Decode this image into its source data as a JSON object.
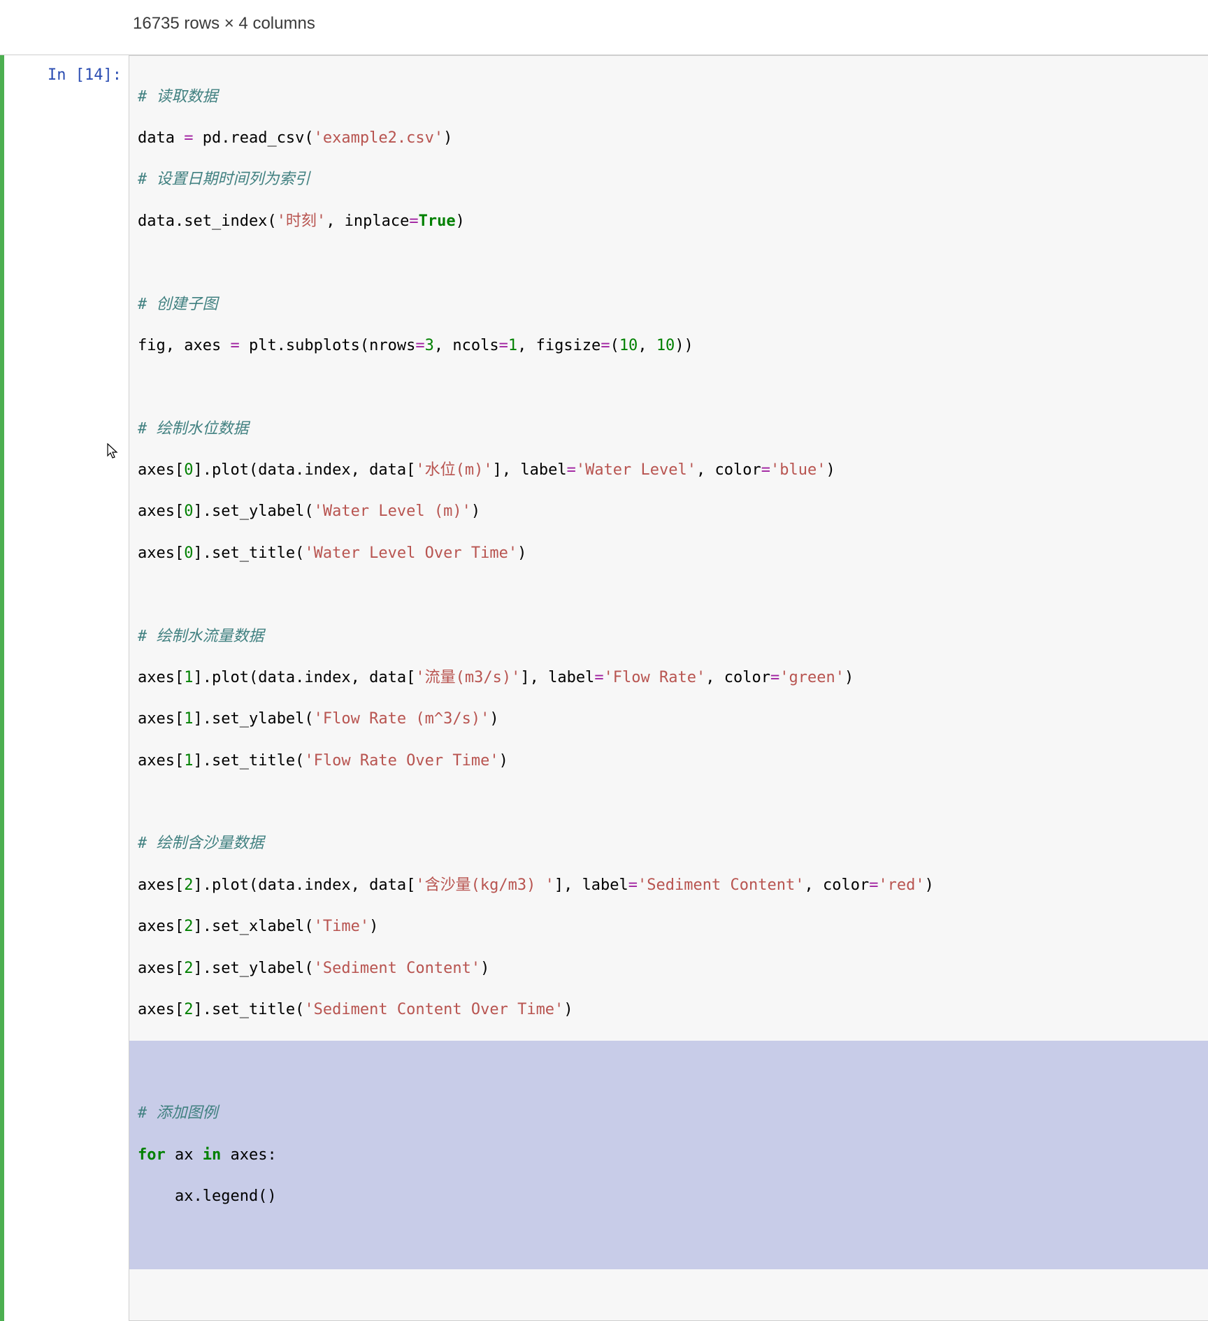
{
  "output": {
    "summary": "16735 rows × 4 columns"
  },
  "cell": {
    "prompt_label": "In",
    "prompt_number": "[14]:",
    "code": {
      "l01_comment": "# 读取数据",
      "l02_a": "data ",
      "l02_op": "=",
      "l02_b": " pd.read_csv(",
      "l02_str": "'example2.csv'",
      "l02_c": ")",
      "l03_comment": "# 设置日期时间列为索引",
      "l04_a": "data.set_index(",
      "l04_str": "'时刻'",
      "l04_b": ", inplace",
      "l04_op": "=",
      "l04_kw": "True",
      "l04_c": ")",
      "l05_blank": "",
      "l06_comment": "# 创建子图",
      "l07_a": "fig, axes ",
      "l07_op1": "=",
      "l07_b": " plt.subplots(nrows",
      "l07_op2": "=",
      "l07_n1": "3",
      "l07_c": ", ncols",
      "l07_op3": "=",
      "l07_n2": "1",
      "l07_d": ", figsize",
      "l07_op4": "=",
      "l07_e": "(",
      "l07_n3": "10",
      "l07_f": ", ",
      "l07_n4": "10",
      "l07_g": "))",
      "l08_blank": "",
      "l09_comment": "# 绘制水位数据",
      "l10_a": "axes[",
      "l10_n": "0",
      "l10_b": "].plot(data.index, data[",
      "l10_str1": "'水位(m)'",
      "l10_c": "], label",
      "l10_op1": "=",
      "l10_str2": "'Water Level'",
      "l10_d": ", color",
      "l10_op2": "=",
      "l10_str3": "'blue'",
      "l10_e": ")",
      "l11_a": "axes[",
      "l11_n": "0",
      "l11_b": "].set_ylabel(",
      "l11_str": "'Water Level (m)'",
      "l11_c": ")",
      "l12_a": "axes[",
      "l12_n": "0",
      "l12_b": "].set_title(",
      "l12_str": "'Water Level Over Time'",
      "l12_c": ")",
      "l13_blank": "",
      "l14_comment": "# 绘制水流量数据",
      "l15_a": "axes[",
      "l15_n": "1",
      "l15_b": "].plot(data.index, data[",
      "l15_str1": "'流量(m3/s)'",
      "l15_c": "], label",
      "l15_op1": "=",
      "l15_str2": "'Flow Rate'",
      "l15_d": ", color",
      "l15_op2": "=",
      "l15_str3": "'green'",
      "l15_e": ")",
      "l16_a": "axes[",
      "l16_n": "1",
      "l16_b": "].set_ylabel(",
      "l16_str": "'Flow Rate (m^3/s)'",
      "l16_c": ")",
      "l17_a": "axes[",
      "l17_n": "1",
      "l17_b": "].set_title(",
      "l17_str": "'Flow Rate Over Time'",
      "l17_c": ")",
      "l18_blank": "",
      "l19_comment": "# 绘制含沙量数据",
      "l20_a": "axes[",
      "l20_n": "2",
      "l20_b": "].plot(data.index, data[",
      "l20_str1": "'含沙量(kg/m3) '",
      "l20_c": "], label",
      "l20_op1": "=",
      "l20_str2": "'Sediment Content'",
      "l20_d": ", color",
      "l20_op2": "=",
      "l20_str3": "'red'",
      "l20_e": ")",
      "l21_a": "axes[",
      "l21_n": "2",
      "l21_b": "].set_xlabel(",
      "l21_str": "'Time'",
      "l21_c": ")",
      "l22_a": "axes[",
      "l22_n": "2",
      "l22_b": "].set_ylabel(",
      "l22_str": "'Sediment Content'",
      "l22_c": ")",
      "l23_a": "axes[",
      "l23_n": "2",
      "l23_b": "].set_title(",
      "l23_str": "'Sediment Content Over Time'",
      "l23_c": ")",
      "l24_blank": "",
      "l25_comment": "# 添加图例",
      "l26_kw1": "for",
      "l26_a": " ax ",
      "l26_kw2": "in",
      "l26_b": " axes:",
      "l27_a": "    ax.legend()"
    }
  }
}
